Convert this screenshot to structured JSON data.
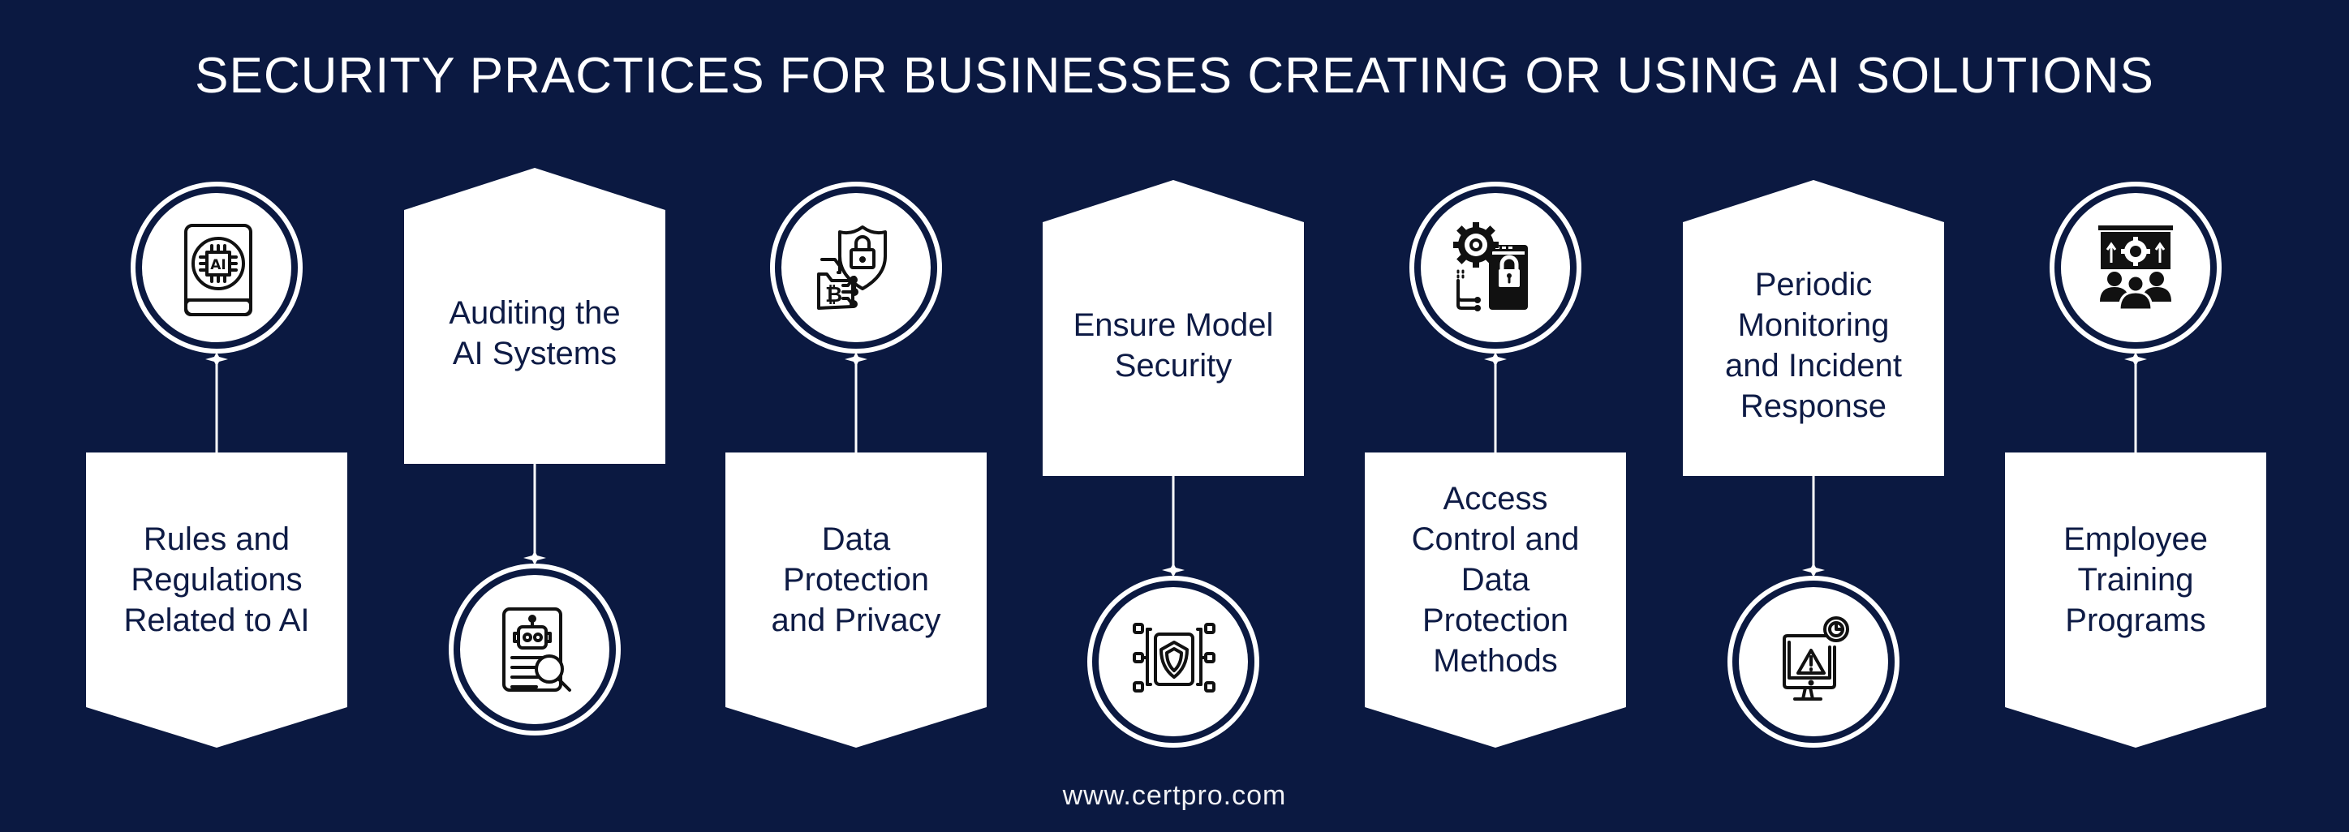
{
  "title": "SECURITY PRACTICES FOR BUSINESSES CREATING OR USING AI SOLUTIONS",
  "footer": "www.certpro.com",
  "colors": {
    "background": "#0b1941",
    "shape_fill": "#ffffff",
    "label_text": "#0e1b45",
    "icon": "#111111"
  },
  "steps": [
    {
      "label": "Rules and Regulations Related to AI",
      "lines": [
        "Rules and",
        "Regulations",
        "Related to AI"
      ],
      "icon": "ai-book-icon",
      "layout": "circle-top"
    },
    {
      "label": "Auditing the AI Systems",
      "lines": [
        "Auditing the",
        "AI Systems"
      ],
      "icon": "robot-document-search-icon",
      "layout": "box-top"
    },
    {
      "label": "Data Protection and Privacy",
      "lines": [
        "Data",
        "Protection",
        "and Privacy"
      ],
      "icon": "folder-shield-lock-icon",
      "layout": "circle-top"
    },
    {
      "label": "Ensure Model Security",
      "lines": [
        "Ensure Model",
        "Security"
      ],
      "icon": "model-shield-icon",
      "layout": "box-top"
    },
    {
      "label": "Access Control and Data Protection Methods",
      "lines": [
        "Access",
        "Control and",
        "Data",
        "Protection",
        "Methods"
      ],
      "icon": "gear-lock-window-icon",
      "layout": "circle-top"
    },
    {
      "label": "Periodic Monitoring and Incident Response",
      "lines": [
        "Periodic",
        "Monitoring",
        "and Incident",
        "Response"
      ],
      "icon": "monitor-warning-icon",
      "layout": "box-top"
    },
    {
      "label": "Employee Training Programs",
      "lines": [
        "Employee",
        "Training",
        "Programs"
      ],
      "icon": "training-presentation-icon",
      "layout": "circle-top"
    }
  ]
}
